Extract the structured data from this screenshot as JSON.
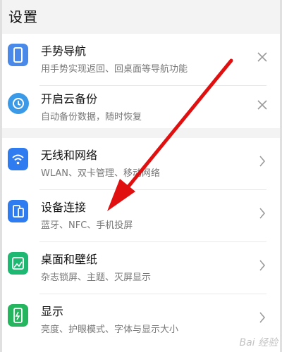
{
  "header": {
    "title": "设置"
  },
  "top_items": [
    {
      "title": "手势导航",
      "subtitle": "用手势实现返回、回桌面等导航功能",
      "icon": "phone-gesture-icon",
      "action": "close-icon",
      "color": "#4a89e8"
    },
    {
      "title": "开启云备份",
      "subtitle": "自动备份数据，随时恢复",
      "icon": "cloud-backup-icon",
      "action": "close-icon",
      "color": "#3a9ae8"
    }
  ],
  "settings": [
    {
      "title": "无线和网络",
      "subtitle": "WLAN、双卡管理、移动网络",
      "icon": "wifi-icon",
      "action": "chevron-right-icon",
      "color": "#2f7cf0"
    },
    {
      "title": "设备连接",
      "subtitle": "蓝牙、NFC、手机投屏",
      "icon": "device-connection-icon",
      "action": "chevron-right-icon",
      "color": "#2f7cf0"
    },
    {
      "title": "桌面和壁纸",
      "subtitle": "杂志锁屏、主题、灭屏显示",
      "icon": "wallpaper-icon",
      "action": "chevron-right-icon",
      "color": "#1fb872"
    },
    {
      "title": "显示",
      "subtitle": "亮度、护眼模式、字体与显示大小",
      "icon": "display-icon",
      "action": "chevron-right-icon",
      "color": "#24b55e"
    }
  ],
  "colors": {
    "annotation_arrow": "#e01010",
    "background": "#f3f3f3"
  },
  "watermark": "Bai 经验"
}
